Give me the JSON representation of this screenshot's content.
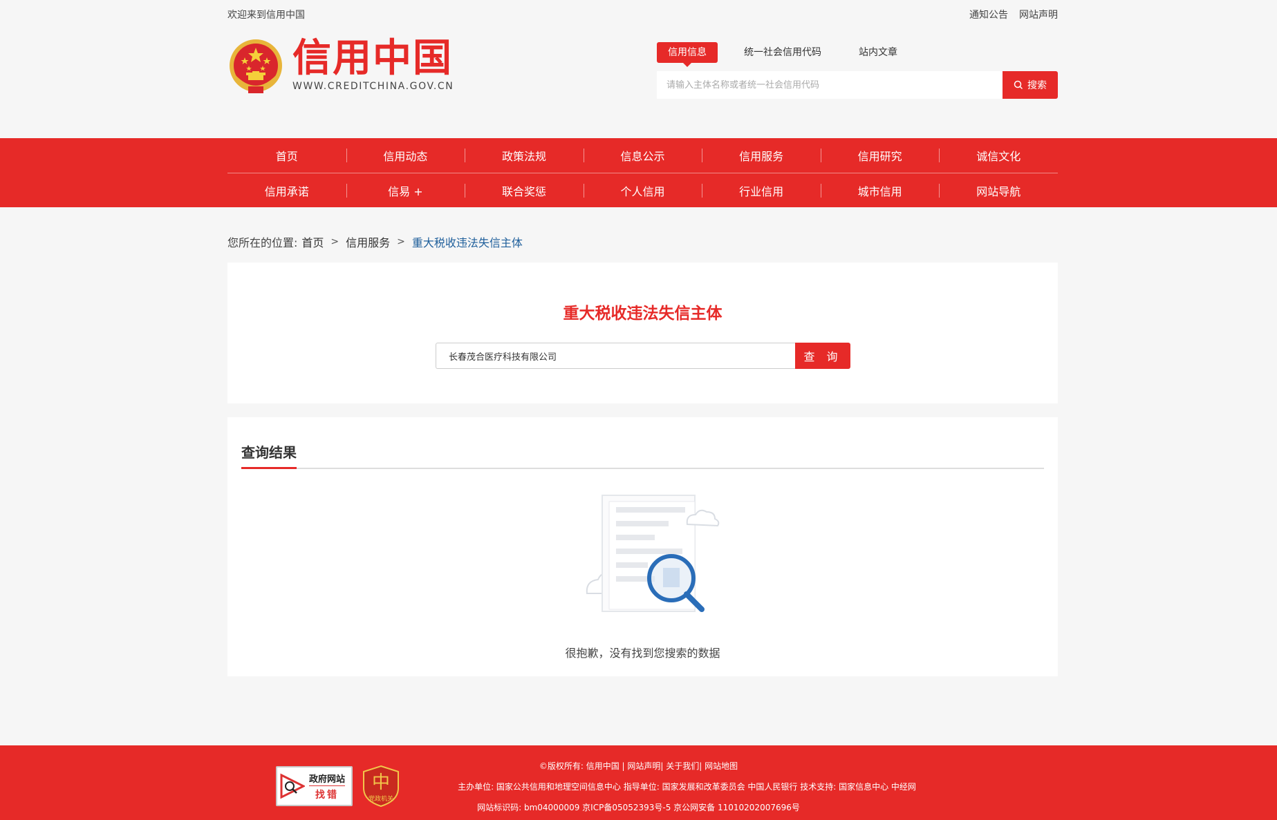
{
  "topbar": {
    "welcome": "欢迎来到信用中国",
    "links": [
      "通知公告",
      "网站声明"
    ]
  },
  "logo": {
    "cn": "信用中国",
    "en": "WWW.CREDITCHINA.GOV.CN"
  },
  "search": {
    "tabs": [
      "信用信息",
      "统一社会信用代码",
      "站内文章"
    ],
    "active_tab": "信用信息",
    "placeholder": "请输入主体名称或者统一社会信用代码",
    "button_label": "搜索"
  },
  "nav": {
    "row1": [
      "首页",
      "信用动态",
      "政策法规",
      "信息公示",
      "信用服务",
      "信用研究",
      "诚信文化"
    ],
    "row2": [
      "信用承诺",
      "信易 +",
      "联合奖惩",
      "个人信用",
      "行业信用",
      "城市信用",
      "网站导航"
    ]
  },
  "breadcrumb": {
    "prefix": "您所在的位置:",
    "items": [
      "首页",
      "信用服务",
      "重大税收违法失信主体"
    ],
    "sep": ">"
  },
  "query": {
    "title": "重大税收违法失信主体",
    "input_value": "长春茂合医疗科技有限公司",
    "button_label": "查 询"
  },
  "result": {
    "title": "查询结果",
    "empty_message": "很抱歉，没有找到您搜索的数据"
  },
  "footer": {
    "gov_badge_line1": "政府网站",
    "gov_badge_line2": "找错",
    "party_badge_label": "党政机关",
    "line1": "©版权所有: 信用中国 | 网站声明| 关于我们| 网站地图",
    "line2": "主办单位: 国家公共信用和地理空间信息中心   指导单位: 国家发展和改革委员会 中国人民银行   技术支持: 国家信息中心 中经网",
    "line3": "网站标识码: bm04000009 京ICP备05052393号-5 京公网安备 11010202007696号"
  },
  "colors": {
    "brand_red": "#e62a28",
    "link_blue": "#1f5f9b",
    "background": "#f6f6f6"
  }
}
